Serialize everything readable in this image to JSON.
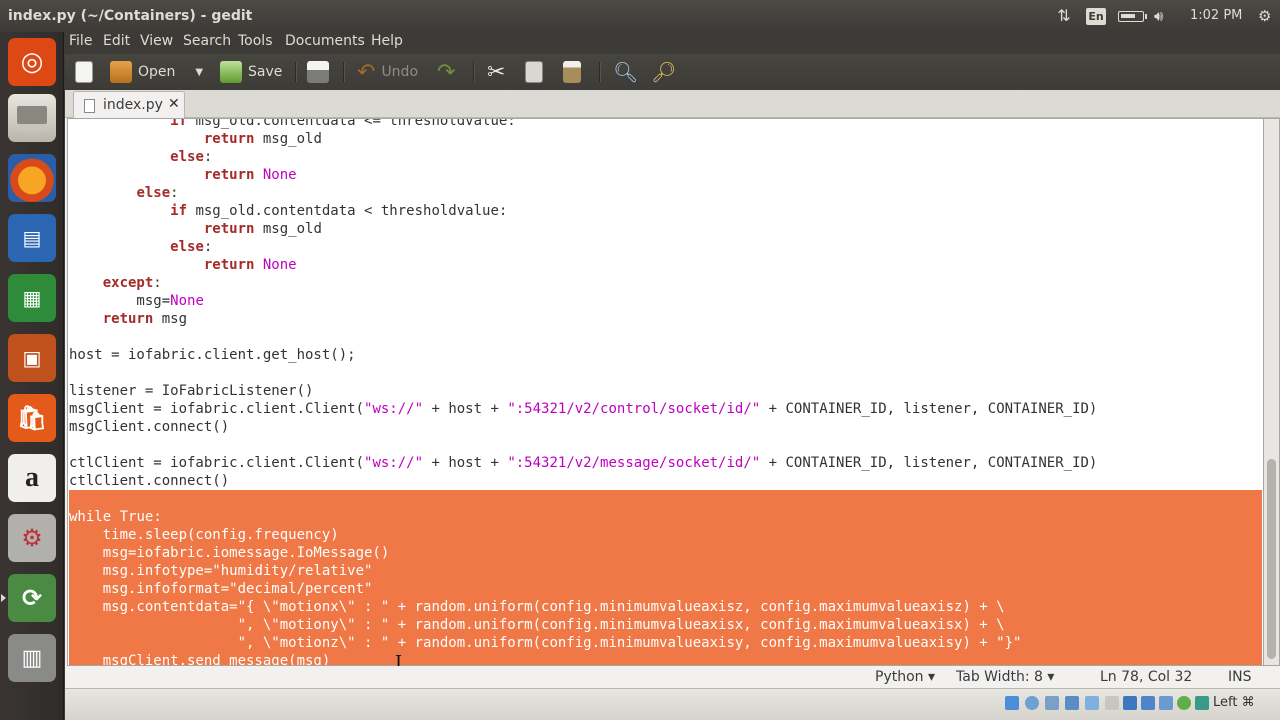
{
  "window": {
    "title": "index.py (~/Containers) - gedit"
  },
  "tray": {
    "language": "En",
    "clock": "1:02 PM"
  },
  "menu": [
    "File",
    "Edit",
    "View",
    "Search",
    "Tools",
    "Documents",
    "Help"
  ],
  "toolbar": {
    "open_label": "Open",
    "save_label": "Save",
    "undo_label": "Undo"
  },
  "tab": {
    "label": "index.py",
    "close": "✕"
  },
  "editor": {
    "lines": [
      "            if msg_old.contentdata <= thresholdvalue:",
      "                return msg_old",
      "            else:",
      "                return None",
      "        else:",
      "            if msg_old.contentdata < thresholdvalue:",
      "                return msg_old",
      "            else:",
      "                return None",
      "    except:",
      "        msg=None",
      "    return msg",
      "",
      "host = iofabric.client.get_host();",
      "",
      "listener = IoFabricListener()",
      "msgClient = iofabric.client.Client(\"ws://\" + host + \":54321/v2/control/socket/id/\" + CONTAINER_ID, listener, CONTAINER_ID)",
      "msgClient.connect()",
      "",
      "ctlClient = iofabric.client.Client(\"ws://\" + host + \":54321/v2/message/socket/id/\" + CONTAINER_ID, listener, CONTAINER_ID)",
      "ctlClient.connect()",
      "",
      "while True:",
      "    time.sleep(config.frequency)",
      "    msg=iofabric.iomessage.IoMessage()",
      "    msg.infotype=\"humidity/relative\"",
      "    msg.infoformat=\"decimal/percent\"",
      "    msg.contentdata=\"{ \\\"motionx\\\" : \" + random.uniform(config.minimumvalueaxisz, config.maximumvalueaxisz) + \\",
      "                    \", \\\"motiony\\\" : \" + random.uniform(config.minimumvalueaxisx, config.maximumvalueaxisx) + \\",
      "                    \", \\\"motionz\\\" : \" + random.uniform(config.minimumvalueaxisy, config.maximumvalueaxisy) + \"}\"",
      "    msgClient.send_message(msg)"
    ],
    "selection_start_line": 21
  },
  "status": {
    "language": "Python",
    "tab_width": "Tab Width: 8",
    "position": "Ln 78, Col 32",
    "mode": "INS"
  },
  "bottom_panel": {
    "keyboard_layout": "Left ⌘"
  },
  "colors": {
    "selection": "#f07746",
    "keyword": "#a52a2a",
    "string": "#c000c0",
    "panel": "#3c3b37"
  }
}
